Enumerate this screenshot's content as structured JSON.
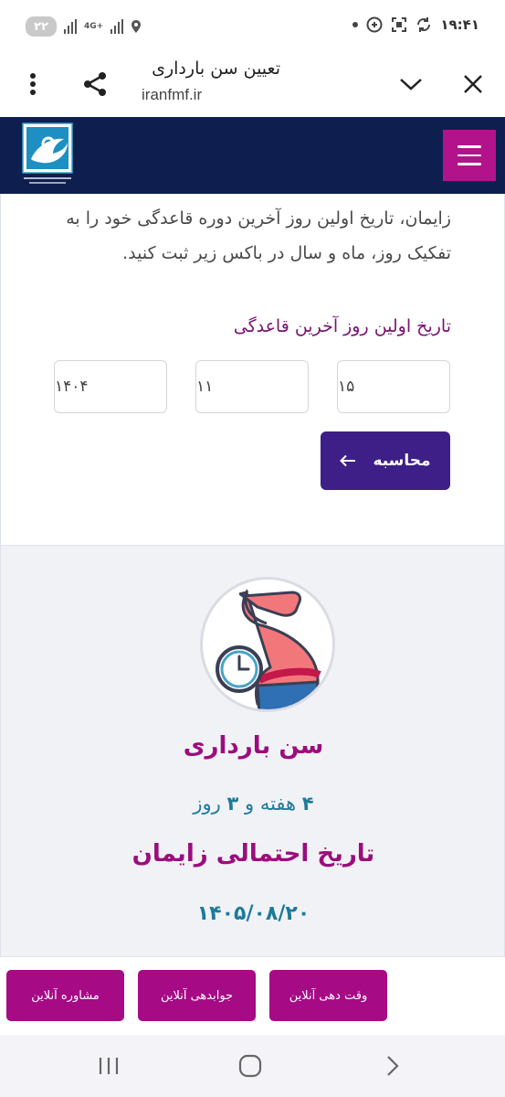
{
  "status_bar": {
    "time": "۱۹:۴۱",
    "battery": "۲۲",
    "network_label": "4G+"
  },
  "browser": {
    "title": "تعیین سن بارداری",
    "url": "iranfmf.ir"
  },
  "site": {
    "logo_name": "logo-icon",
    "accent_color": "#b3138a",
    "header_color": "#0e1f4f"
  },
  "form": {
    "intro_text": "زایمان، تاریخ اولین روز آخرین دوره قاعدگی خود را به تفکیک روز، ماه و سال در باکس زیر ثبت کنید.",
    "field_label": "تاریخ اولین روز آخرین قاعدگی",
    "day_value": "۱۵",
    "month_value": "۱۱",
    "year_value": "۱۴۰۴",
    "calculate_label": "محاسبه"
  },
  "result": {
    "age_title": "سن بارداری",
    "weeks": "۴",
    "weeks_unit": "هفته و",
    "days": "۳",
    "days_unit": "روز",
    "due_title": "تاریخ احتمالی زایمان",
    "due_date": "۱۴۰۵/۰۸/۲۰"
  },
  "actions": {
    "appointment_label": "وقت دهی آنلاین",
    "answer_label": "جوابدهی آنلاین",
    "consult_label": "مشاوره آنلاین"
  }
}
